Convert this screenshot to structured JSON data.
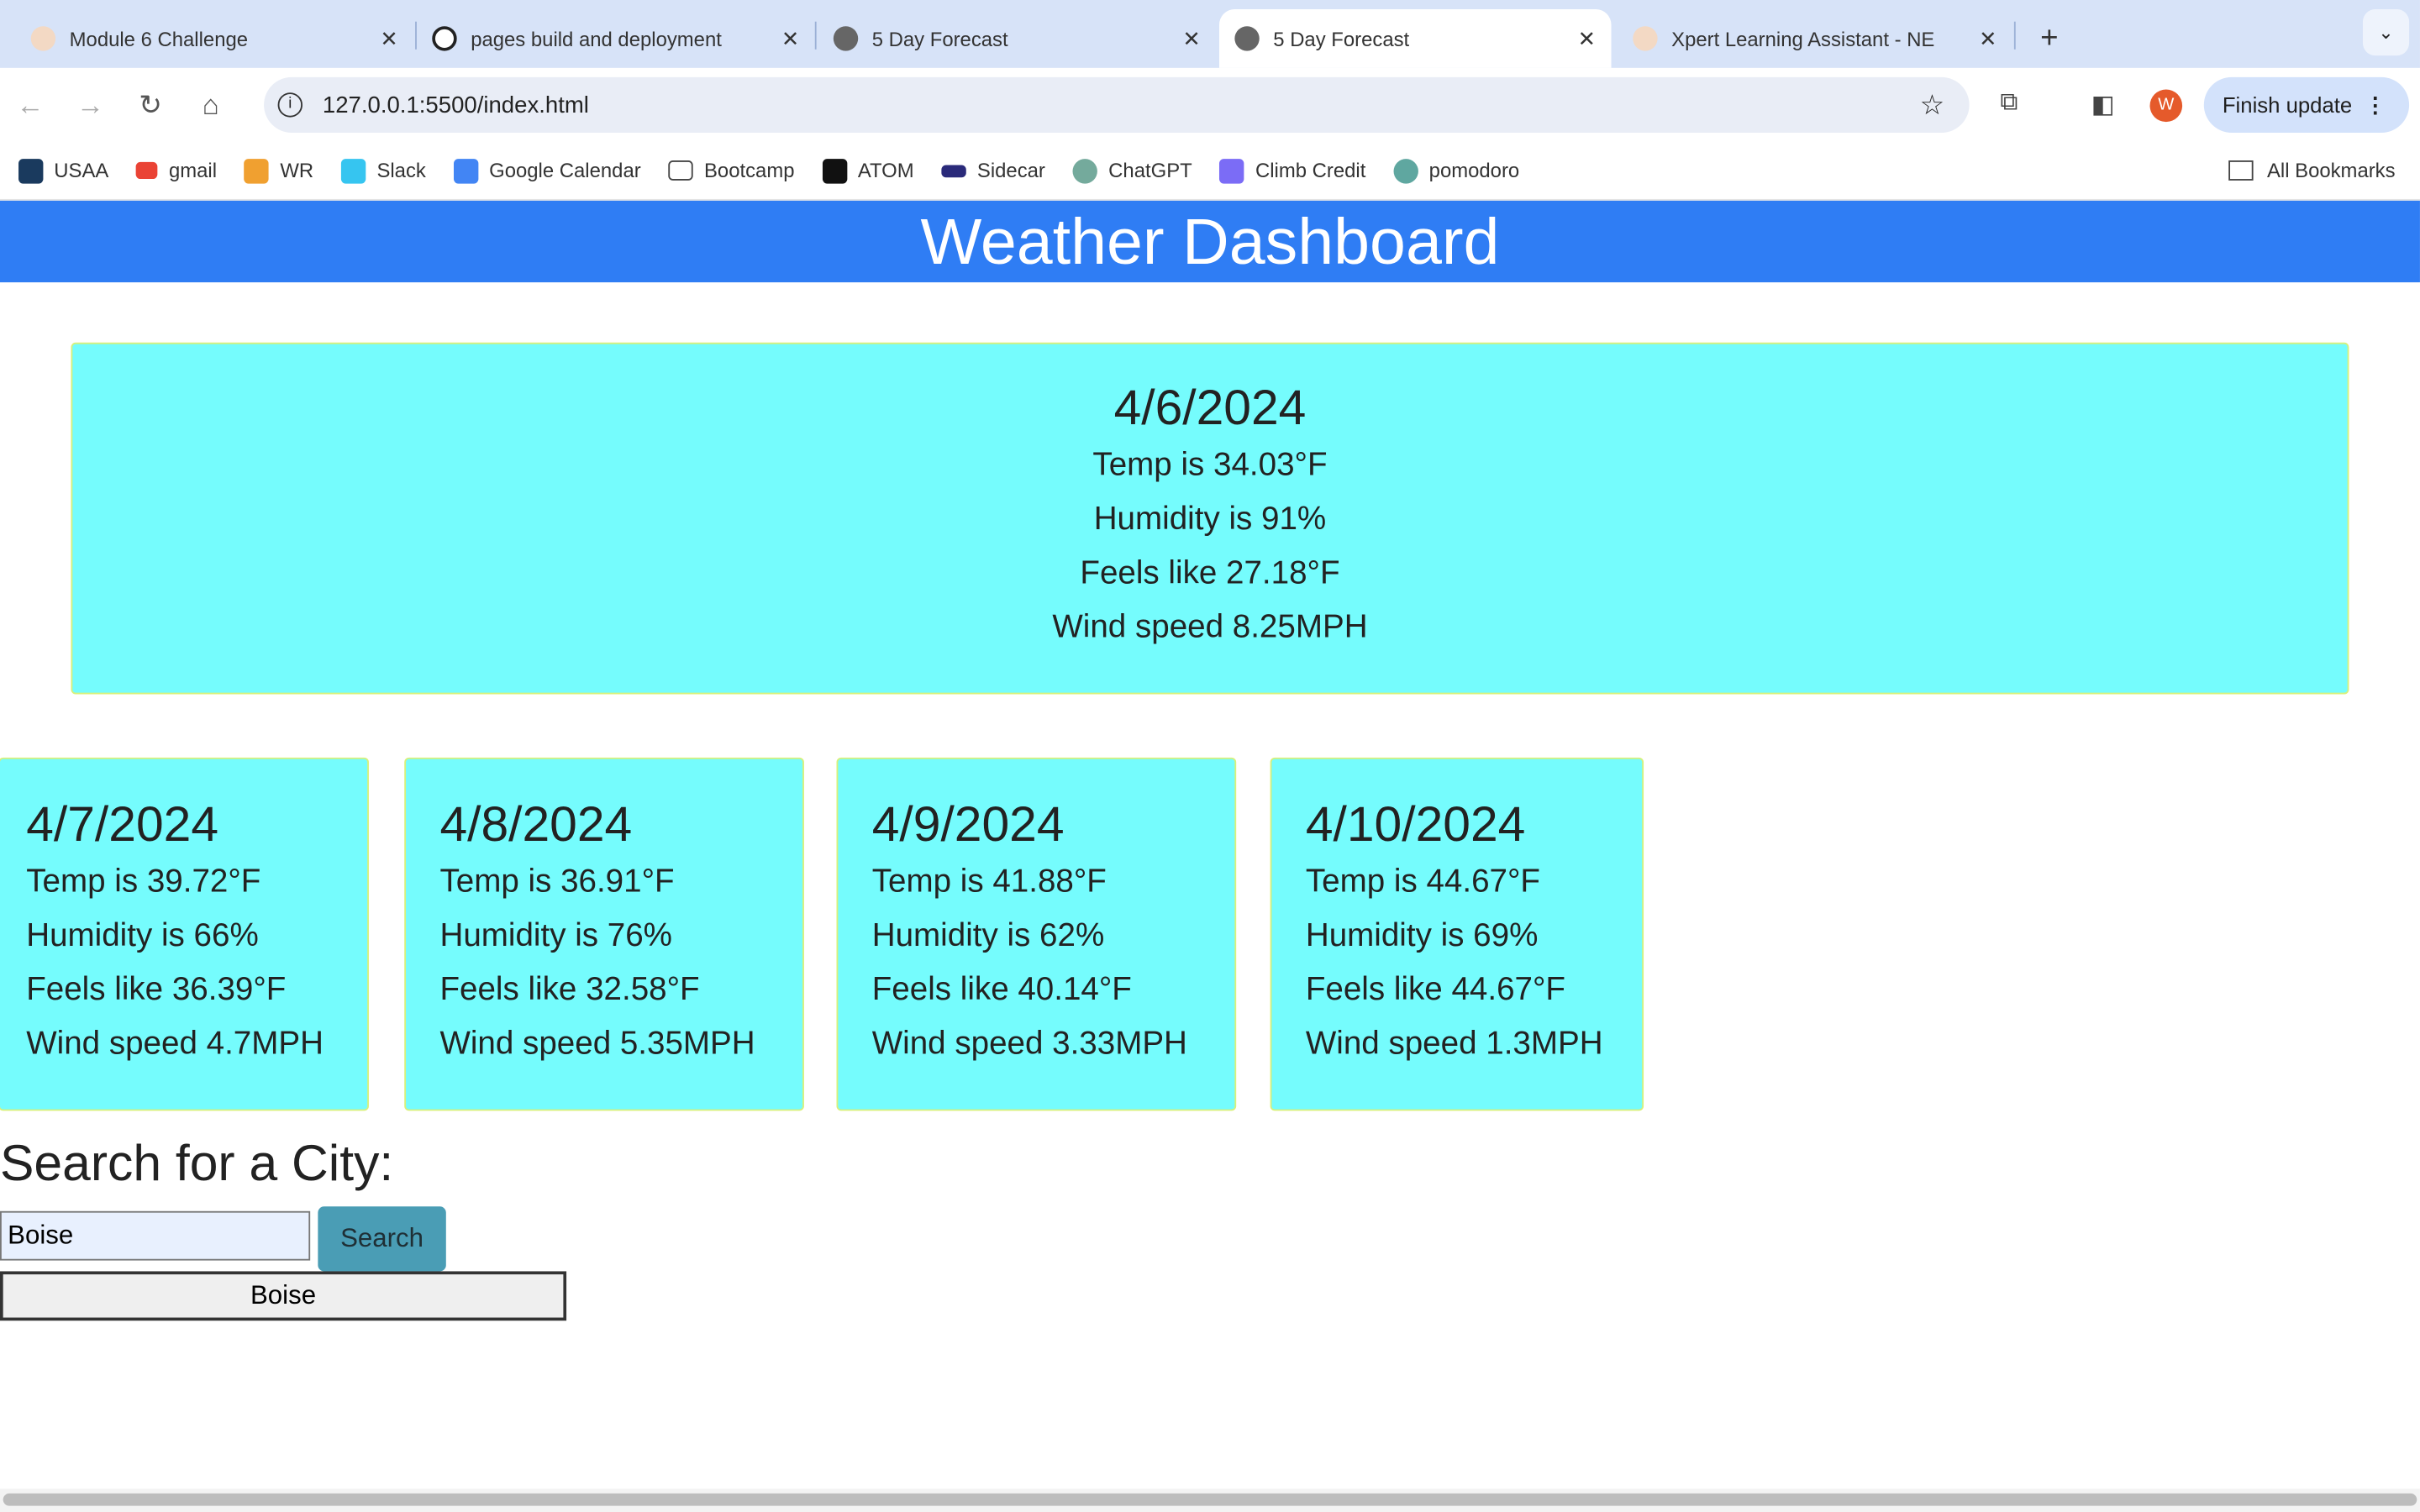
{
  "browser": {
    "tabs": [
      {
        "title": "Module 6 Challenge",
        "active": false
      },
      {
        "title": "pages build and deployment",
        "active": false
      },
      {
        "title": "5 Day Forecast",
        "active": false
      },
      {
        "title": "5 Day Forecast",
        "active": true
      },
      {
        "title": "Xpert Learning Assistant - NE",
        "active": false
      }
    ],
    "new_tab": "+",
    "close": "✕",
    "url": "127.0.0.1:5500/index.html",
    "profile_initial": "W",
    "finish_update": "Finish update",
    "bookmarks": [
      "USAA",
      "gmail",
      "WR",
      "Slack",
      "Google Calendar",
      "Bootcamp",
      "ATOM",
      "Sidecar",
      "ChatGPT",
      "Climb Credit",
      "pomodoro"
    ],
    "all_bookmarks": "All Bookmarks"
  },
  "page": {
    "title": "Weather Dashboard",
    "today": {
      "date": "4/6/2024",
      "temp": "Temp is 34.03°F",
      "humidity": "Humidity is 91%",
      "feels": "Feels like 27.18°F",
      "wind": "Wind speed 8.25MPH"
    },
    "forecast": [
      {
        "date": "4/7/2024",
        "temp": "Temp is 39.72°F",
        "humidity": "Humidity is 66%",
        "feels": "Feels like 36.39°F",
        "wind": "Wind speed 4.7MPH"
      },
      {
        "date": "4/8/2024",
        "temp": "Temp is 36.91°F",
        "humidity": "Humidity is 76%",
        "feels": "Feels like 32.58°F",
        "wind": "Wind speed 5.35MPH"
      },
      {
        "date": "4/9/2024",
        "temp": "Temp is 41.88°F",
        "humidity": "Humidity is 62%",
        "feels": "Feels like 40.14°F",
        "wind": "Wind speed 3.33MPH"
      },
      {
        "date": "4/10/2024",
        "temp": "Temp is 44.67°F",
        "humidity": "Humidity is 69%",
        "feels": "Feels like 44.67°F",
        "wind": "Wind speed 1.3MPH"
      }
    ],
    "search_title": "Search for a City:",
    "search_value": "Boise",
    "search_button": "Search",
    "history": [
      "Boise"
    ]
  }
}
